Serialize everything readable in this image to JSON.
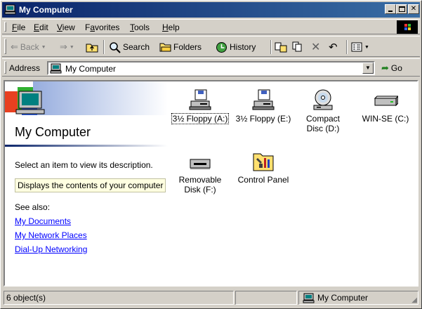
{
  "window": {
    "title": "My Computer"
  },
  "menu": [
    {
      "label": "File",
      "key": "F",
      "rest": "ile"
    },
    {
      "label": "Edit",
      "key": "E",
      "rest": "dit"
    },
    {
      "label": "View",
      "key": "V",
      "rest": "iew"
    },
    {
      "label": "Favorites",
      "key": "a",
      "pre": "F",
      "rest": "vorites"
    },
    {
      "label": "Tools",
      "key": "T",
      "rest": "ools"
    },
    {
      "label": "Help",
      "key": "H",
      "rest": "elp"
    }
  ],
  "toolbar": {
    "back": "Back",
    "search": "Search",
    "folders": "Folders",
    "history": "History"
  },
  "address": {
    "label": "Address",
    "value": "My Computer",
    "go": "Go"
  },
  "leftpane": {
    "title": "My Computer",
    "prompt": "Select an item to view its description.",
    "tooltip": "Displays the contents of your computer",
    "see_also": "See also:",
    "links": [
      "My Documents",
      "My Network Places",
      "Dial-Up Networking"
    ]
  },
  "items": [
    {
      "label": "3½ Floppy (A:)",
      "icon": "floppy-drive-icon"
    },
    {
      "label": "3½ Floppy (E:)",
      "icon": "floppy-drive-icon"
    },
    {
      "label": "Compact Disc (D:)",
      "icon": "cd-drive-icon"
    },
    {
      "label": "WIN-SE (C:)",
      "icon": "hard-drive-icon"
    },
    {
      "label": "Removable Disk (F:)",
      "icon": "removable-drive-icon"
    },
    {
      "label": "Control Panel",
      "icon": "control-panel-icon"
    }
  ],
  "status": {
    "count": "6 object(s)",
    "zone": "My Computer"
  },
  "colors": {
    "titlebar": "#0a246a",
    "face": "#d4d0c8",
    "link": "#0000ff",
    "tooltip_bg": "#ffffe1"
  }
}
